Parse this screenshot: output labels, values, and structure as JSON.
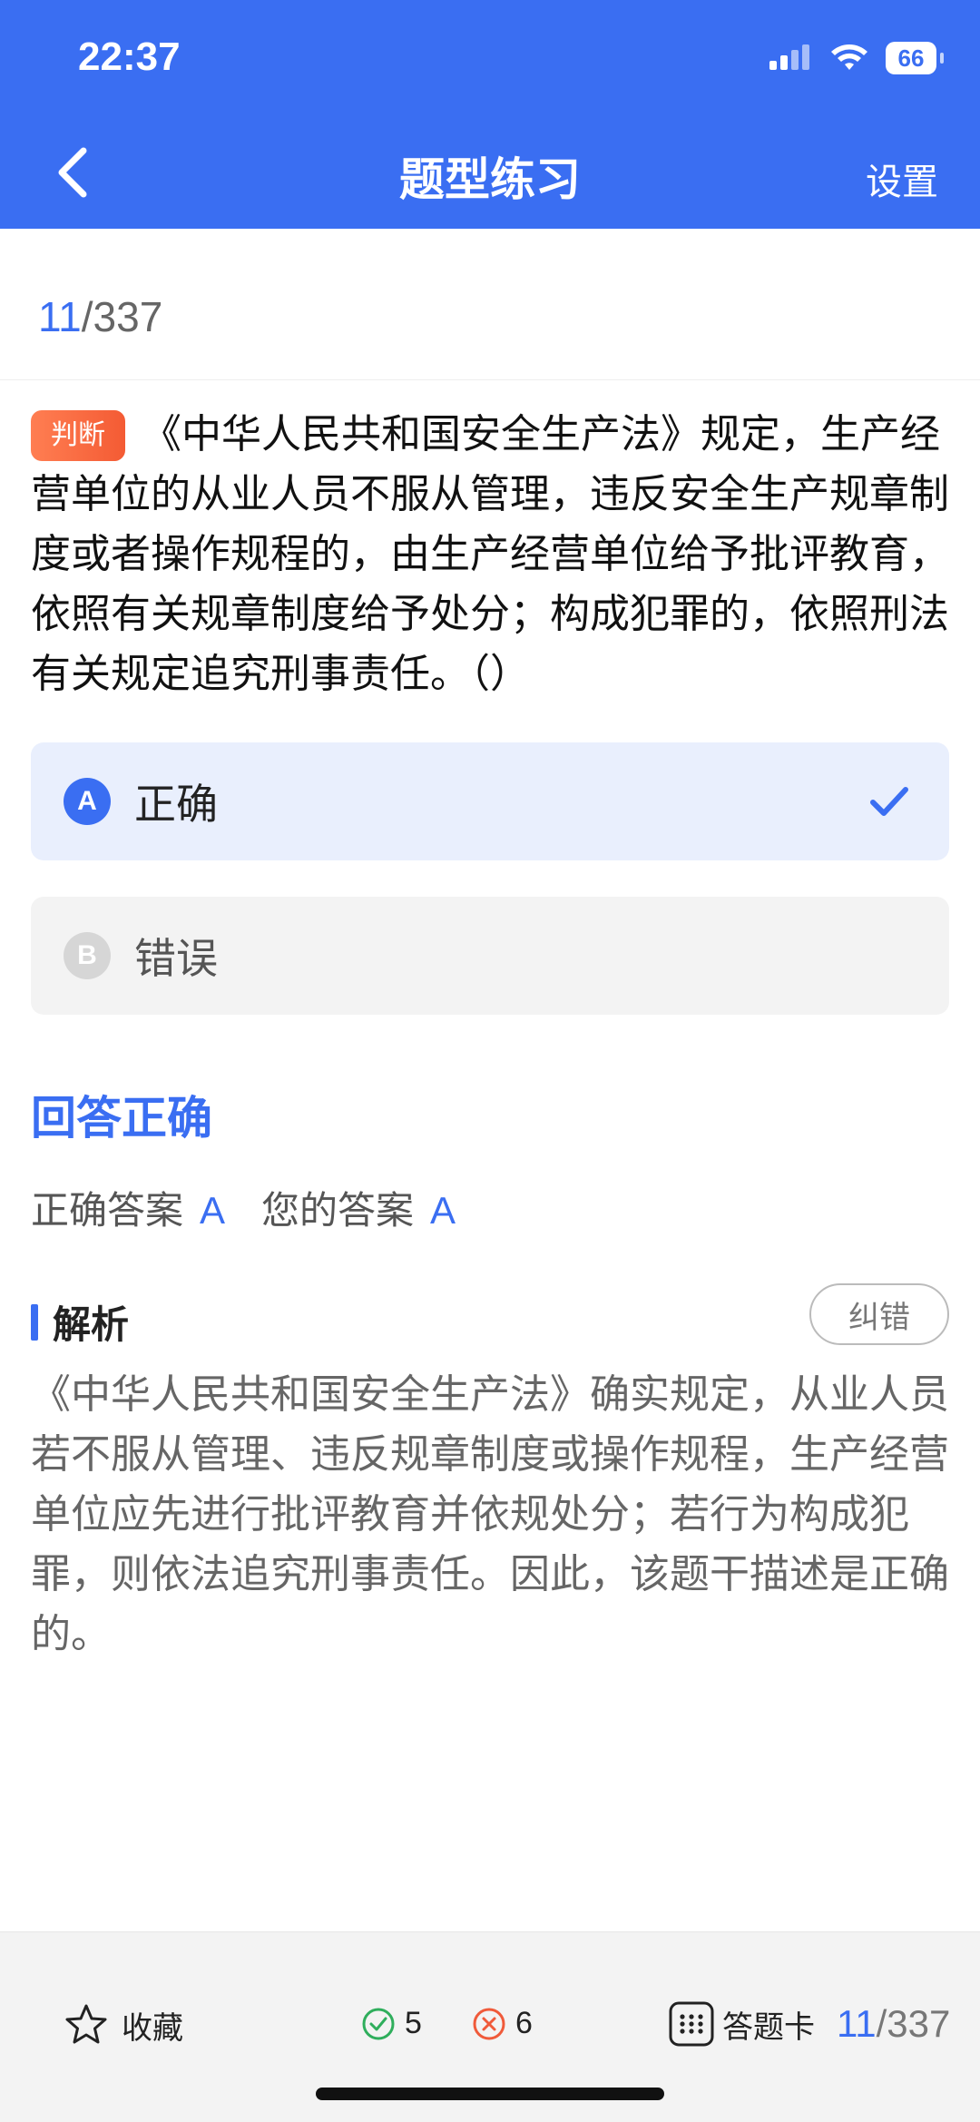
{
  "status": {
    "time": "22:37",
    "battery": "66"
  },
  "nav": {
    "title": "题型练习",
    "settings": "设置"
  },
  "counter": {
    "current": "11",
    "total": "/337"
  },
  "question": {
    "type": "判断",
    "text": "《中华人民共和国安全生产法》规定，生产经营单位的从业人员不服从管理，违反安全生产规章制度或者操作规程的，由生产经营单位给予批评教育，依照有关规章制度给予处分；构成犯罪的，依照刑法有关规定追究刑事责任。（）"
  },
  "options": [
    {
      "letter": "A",
      "text": "正确",
      "selected": true
    },
    {
      "letter": "B",
      "text": "错误",
      "selected": false
    }
  ],
  "result": {
    "title": "回答正确",
    "correct_label": "正确答案",
    "correct_value": "A",
    "your_label": "您的答案",
    "your_value": "A"
  },
  "analysis": {
    "title": "解析",
    "report_button": "纠错",
    "text": "《中华人民共和国安全生产法》确实规定，从业人员若不服从管理、违反规章制度或操作规程，生产经营单位应先进行批评教育并依规处分；若行为构成犯罪，则依法追究刑事责任。因此，该题干描述是正确的。"
  },
  "bottom": {
    "favorite": "收藏",
    "correct_count": "5",
    "wrong_count": "6",
    "answer_card": "答题卡",
    "page_current": "11",
    "page_total": "/337"
  },
  "colors": {
    "primary": "#3a6ef2",
    "tag": "#f45b34",
    "correct": "#2fae5c",
    "wrong": "#f05a3a"
  }
}
